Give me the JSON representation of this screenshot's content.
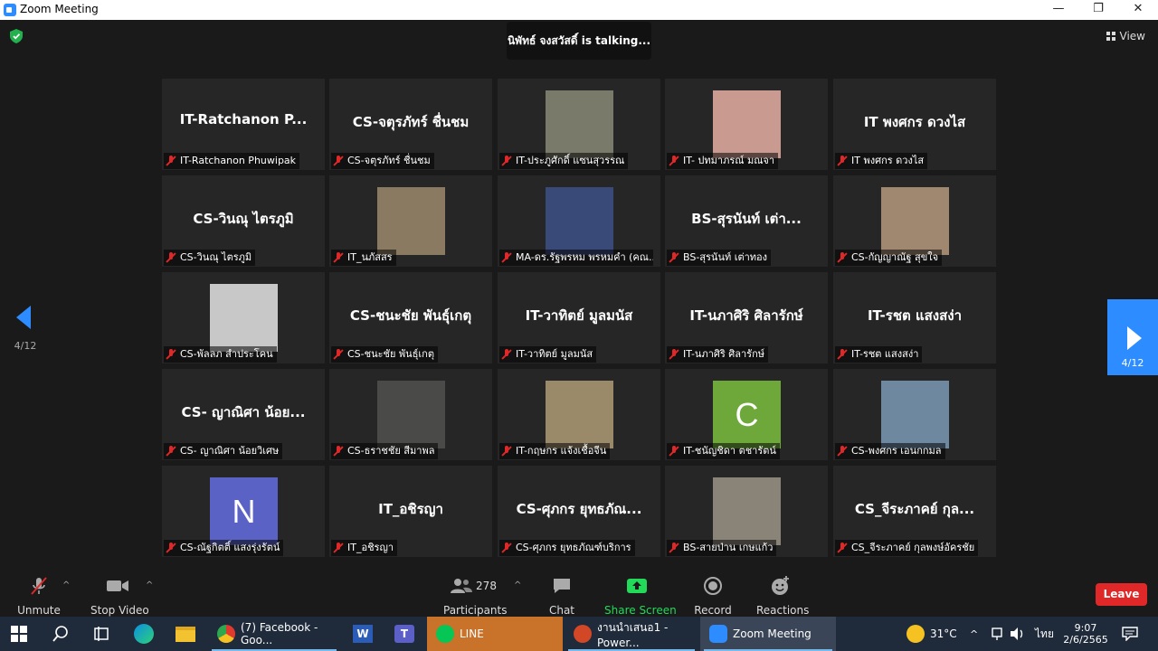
{
  "window": {
    "title": "Zoom Meeting",
    "min": "—",
    "restore": "❐",
    "close": "✕"
  },
  "header": {
    "talking": "นิพัทธ์ จงสวัสดิ์ is  talking...",
    "view_label": "View"
  },
  "pager": {
    "left_page": "4/12",
    "right_page": "4/12"
  },
  "participants": [
    {
      "big": "IT-Ratchanon  P...",
      "label": "IT-Ratchanon Phuwipak"
    },
    {
      "big": "CS-จตุรภัทร์ ชื่นชม",
      "label": "CS-จตุรภัทร์ ชื่นชม"
    },
    {
      "big": "",
      "label": "IT-ประภูศักดิ์ แซนสุวรรณ",
      "thumb": "#7a7a6a"
    },
    {
      "big": "",
      "label": "IT- ปทมาภรณ์ มณจา",
      "thumb": "#c89a90"
    },
    {
      "big": "IT พงศกร ดวงไส",
      "label": "IT พงศกร ดวงไส"
    },
    {
      "big": "CS-วินณุ ไตรภูมิ",
      "label": "CS-วินณุ ไตรภูมิ"
    },
    {
      "big": "",
      "label": "IT_นภัสสร",
      "thumb": "#8a7a62"
    },
    {
      "big": "",
      "label": "MA-ดร.รัฐพรหม พรหมคำ (คณ...",
      "thumb": "#3a4a78"
    },
    {
      "big": "BS-สุรนันท์   เต่า...",
      "label": "BS-สุรนันท์   เต่าทอง"
    },
    {
      "big": "",
      "label": "CS-กัญญาณัฐ  สุขใจ",
      "thumb": "#a08870"
    },
    {
      "big": "",
      "label": "CS-พัลลภ สำประโคน",
      "thumb": "#c8c8c8"
    },
    {
      "big": "CS-ชนะชัย พันธุ์เกตุ",
      "label": "CS-ชนะชัย พันธุ์เกตุ"
    },
    {
      "big": "IT-วาทิตย์ มูลมนัส",
      "label": "IT-วาทิตย์ มูลมนัส"
    },
    {
      "big": "IT-นภาศิริ ศิลารักษ์",
      "label": "IT-นภาศิริ ศิลารักษ์"
    },
    {
      "big": "IT-รชต แสงสง่า",
      "label": "IT-รชต แสงสง่า"
    },
    {
      "big": "CS- ญาณิศา น้อย...",
      "label": "CS- ญาณิศา น้อยวิเศษ"
    },
    {
      "big": "",
      "label": "CS-ธราชชัย สีมาพล",
      "thumb": "#4a4a48"
    },
    {
      "big": "",
      "label": "IT-กฤษกร แจ้งเชื้อจีน",
      "thumb": "#9a8a6a"
    },
    {
      "big": "",
      "label": "IT-ชนัญชิดา ตชารัตน์",
      "thumb": "#6fa83a",
      "letter": "C"
    },
    {
      "big": "",
      "label": "CS-พงศกร เอนกกมล",
      "thumb": "#6e88a0"
    },
    {
      "big": "",
      "label": "CS-ณัฐกิตติ์ แสงรุ่งรัตน์",
      "thumb": "#5a62c6",
      "letter": "N"
    },
    {
      "big": "IT_อชิรญา",
      "label": "IT_อชิรญา"
    },
    {
      "big": "CS-ศุภกร ยุทธภัณ...",
      "label": "CS-ศุภกร ยุทธภัณฑ์บริการ"
    },
    {
      "big": "",
      "label": "BS-สายป่าน เกษแก้ว",
      "thumb": "#8a8478"
    },
    {
      "big": "CS_จีระภาคย์ กุล...",
      "label": "CS_จีระภาคย์ กุลพงษ์อัครชัย"
    }
  ],
  "toolbar": {
    "unmute": "Unmute",
    "stop_video": "Stop Video",
    "participants": "Participants",
    "participant_count": "278",
    "chat": "Chat",
    "share": "Share Screen",
    "record": "Record",
    "reactions": "Reactions",
    "leave": "Leave"
  },
  "taskbar": {
    "chrome": "(7) Facebook - Goo...",
    "line": "LINE",
    "ppt": "งานนำเสนอ1 - Power...",
    "zoom": "Zoom Meeting",
    "temp": "31°C",
    "lang": "ไทย",
    "time": "9:07",
    "date": "2/6/2565"
  },
  "colors": {
    "accent": "#2d8cff",
    "leave": "#e02828",
    "share": "#23d959",
    "taskbar_line": "#c8722a"
  }
}
